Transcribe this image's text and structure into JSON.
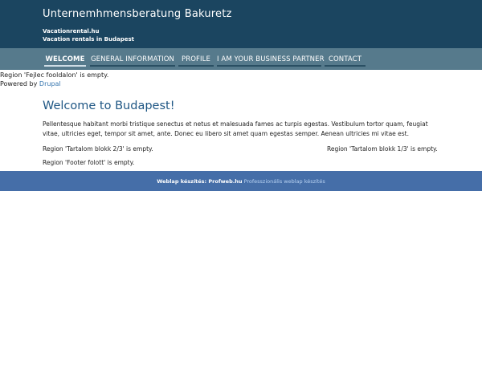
{
  "header": {
    "site_name": "Unternemhmensberatung Bakuretz",
    "slogan_line1": "Vacationrental.hu",
    "slogan_line2": "Vacation rentals in Budapest"
  },
  "nav": {
    "items": [
      {
        "label": "WELCOME"
      },
      {
        "label": "GENERAL INFORMATION"
      },
      {
        "label": "PROFILE"
      },
      {
        "label": "I AM YOUR BUSINESS PARTNER"
      },
      {
        "label": "CONTACT"
      }
    ]
  },
  "top_region": {
    "empty_notice": "Region 'Fejlec fooldalon' is empty.",
    "powered_by_prefix": "Powered by",
    "powered_by_link": "Drupal"
  },
  "content": {
    "title": "Welcome to Budapest!",
    "body": "Pellentesque habitant morbi tristique senectus et netus et malesuada fames ac turpis egestas. Vestibulum tortor quam, feugiat vitae, ultricies eget, tempor sit amet, ante. Donec eu libero sit amet quam egestas semper. Aenean ultricies mi vitae est.",
    "region_left": "Region 'Tartalom blokk 2/3' is empty.",
    "region_right": "Region 'Tartalom blokk 1/3' is empty.",
    "region_footer": "Region 'Footer folott' is empty."
  },
  "footer": {
    "prefix": "Weblap készítés: Profweb.hu",
    "link": "Professzionális weblap készítés"
  }
}
